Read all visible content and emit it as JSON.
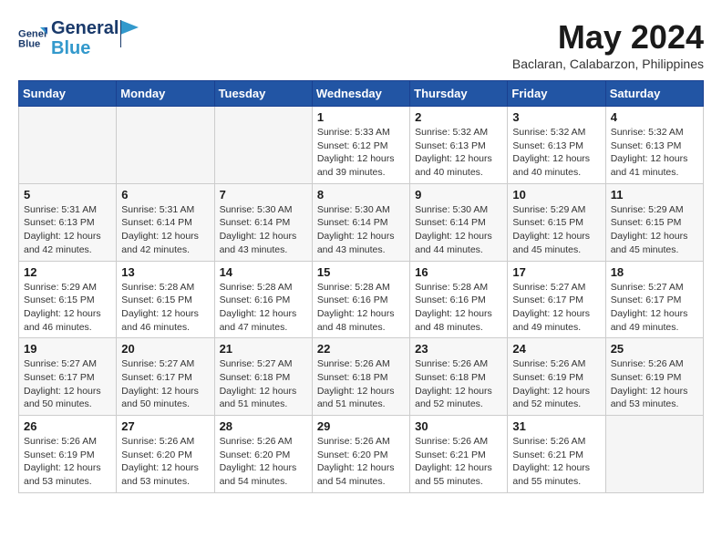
{
  "header": {
    "logo_line1": "General",
    "logo_line2": "Blue",
    "month_title": "May 2024",
    "location": "Baclaran, Calabarzon, Philippines"
  },
  "days_of_week": [
    "Sunday",
    "Monday",
    "Tuesday",
    "Wednesday",
    "Thursday",
    "Friday",
    "Saturday"
  ],
  "weeks": [
    [
      {
        "day": "",
        "info": "",
        "empty": true
      },
      {
        "day": "",
        "info": "",
        "empty": true
      },
      {
        "day": "",
        "info": "",
        "empty": true
      },
      {
        "day": "1",
        "info": "Sunrise: 5:33 AM\nSunset: 6:12 PM\nDaylight: 12 hours\nand 39 minutes.",
        "empty": false
      },
      {
        "day": "2",
        "info": "Sunrise: 5:32 AM\nSunset: 6:13 PM\nDaylight: 12 hours\nand 40 minutes.",
        "empty": false
      },
      {
        "day": "3",
        "info": "Sunrise: 5:32 AM\nSunset: 6:13 PM\nDaylight: 12 hours\nand 40 minutes.",
        "empty": false
      },
      {
        "day": "4",
        "info": "Sunrise: 5:32 AM\nSunset: 6:13 PM\nDaylight: 12 hours\nand 41 minutes.",
        "empty": false
      }
    ],
    [
      {
        "day": "5",
        "info": "Sunrise: 5:31 AM\nSunset: 6:13 PM\nDaylight: 12 hours\nand 42 minutes.",
        "empty": false
      },
      {
        "day": "6",
        "info": "Sunrise: 5:31 AM\nSunset: 6:14 PM\nDaylight: 12 hours\nand 42 minutes.",
        "empty": false
      },
      {
        "day": "7",
        "info": "Sunrise: 5:30 AM\nSunset: 6:14 PM\nDaylight: 12 hours\nand 43 minutes.",
        "empty": false
      },
      {
        "day": "8",
        "info": "Sunrise: 5:30 AM\nSunset: 6:14 PM\nDaylight: 12 hours\nand 43 minutes.",
        "empty": false
      },
      {
        "day": "9",
        "info": "Sunrise: 5:30 AM\nSunset: 6:14 PM\nDaylight: 12 hours\nand 44 minutes.",
        "empty": false
      },
      {
        "day": "10",
        "info": "Sunrise: 5:29 AM\nSunset: 6:15 PM\nDaylight: 12 hours\nand 45 minutes.",
        "empty": false
      },
      {
        "day": "11",
        "info": "Sunrise: 5:29 AM\nSunset: 6:15 PM\nDaylight: 12 hours\nand 45 minutes.",
        "empty": false
      }
    ],
    [
      {
        "day": "12",
        "info": "Sunrise: 5:29 AM\nSunset: 6:15 PM\nDaylight: 12 hours\nand 46 minutes.",
        "empty": false
      },
      {
        "day": "13",
        "info": "Sunrise: 5:28 AM\nSunset: 6:15 PM\nDaylight: 12 hours\nand 46 minutes.",
        "empty": false
      },
      {
        "day": "14",
        "info": "Sunrise: 5:28 AM\nSunset: 6:16 PM\nDaylight: 12 hours\nand 47 minutes.",
        "empty": false
      },
      {
        "day": "15",
        "info": "Sunrise: 5:28 AM\nSunset: 6:16 PM\nDaylight: 12 hours\nand 48 minutes.",
        "empty": false
      },
      {
        "day": "16",
        "info": "Sunrise: 5:28 AM\nSunset: 6:16 PM\nDaylight: 12 hours\nand 48 minutes.",
        "empty": false
      },
      {
        "day": "17",
        "info": "Sunrise: 5:27 AM\nSunset: 6:17 PM\nDaylight: 12 hours\nand 49 minutes.",
        "empty": false
      },
      {
        "day": "18",
        "info": "Sunrise: 5:27 AM\nSunset: 6:17 PM\nDaylight: 12 hours\nand 49 minutes.",
        "empty": false
      }
    ],
    [
      {
        "day": "19",
        "info": "Sunrise: 5:27 AM\nSunset: 6:17 PM\nDaylight: 12 hours\nand 50 minutes.",
        "empty": false
      },
      {
        "day": "20",
        "info": "Sunrise: 5:27 AM\nSunset: 6:17 PM\nDaylight: 12 hours\nand 50 minutes.",
        "empty": false
      },
      {
        "day": "21",
        "info": "Sunrise: 5:27 AM\nSunset: 6:18 PM\nDaylight: 12 hours\nand 51 minutes.",
        "empty": false
      },
      {
        "day": "22",
        "info": "Sunrise: 5:26 AM\nSunset: 6:18 PM\nDaylight: 12 hours\nand 51 minutes.",
        "empty": false
      },
      {
        "day": "23",
        "info": "Sunrise: 5:26 AM\nSunset: 6:18 PM\nDaylight: 12 hours\nand 52 minutes.",
        "empty": false
      },
      {
        "day": "24",
        "info": "Sunrise: 5:26 AM\nSunset: 6:19 PM\nDaylight: 12 hours\nand 52 minutes.",
        "empty": false
      },
      {
        "day": "25",
        "info": "Sunrise: 5:26 AM\nSunset: 6:19 PM\nDaylight: 12 hours\nand 53 minutes.",
        "empty": false
      }
    ],
    [
      {
        "day": "26",
        "info": "Sunrise: 5:26 AM\nSunset: 6:19 PM\nDaylight: 12 hours\nand 53 minutes.",
        "empty": false
      },
      {
        "day": "27",
        "info": "Sunrise: 5:26 AM\nSunset: 6:20 PM\nDaylight: 12 hours\nand 53 minutes.",
        "empty": false
      },
      {
        "day": "28",
        "info": "Sunrise: 5:26 AM\nSunset: 6:20 PM\nDaylight: 12 hours\nand 54 minutes.",
        "empty": false
      },
      {
        "day": "29",
        "info": "Sunrise: 5:26 AM\nSunset: 6:20 PM\nDaylight: 12 hours\nand 54 minutes.",
        "empty": false
      },
      {
        "day": "30",
        "info": "Sunrise: 5:26 AM\nSunset: 6:21 PM\nDaylight: 12 hours\nand 55 minutes.",
        "empty": false
      },
      {
        "day": "31",
        "info": "Sunrise: 5:26 AM\nSunset: 6:21 PM\nDaylight: 12 hours\nand 55 minutes.",
        "empty": false
      },
      {
        "day": "",
        "info": "",
        "empty": true
      }
    ]
  ]
}
